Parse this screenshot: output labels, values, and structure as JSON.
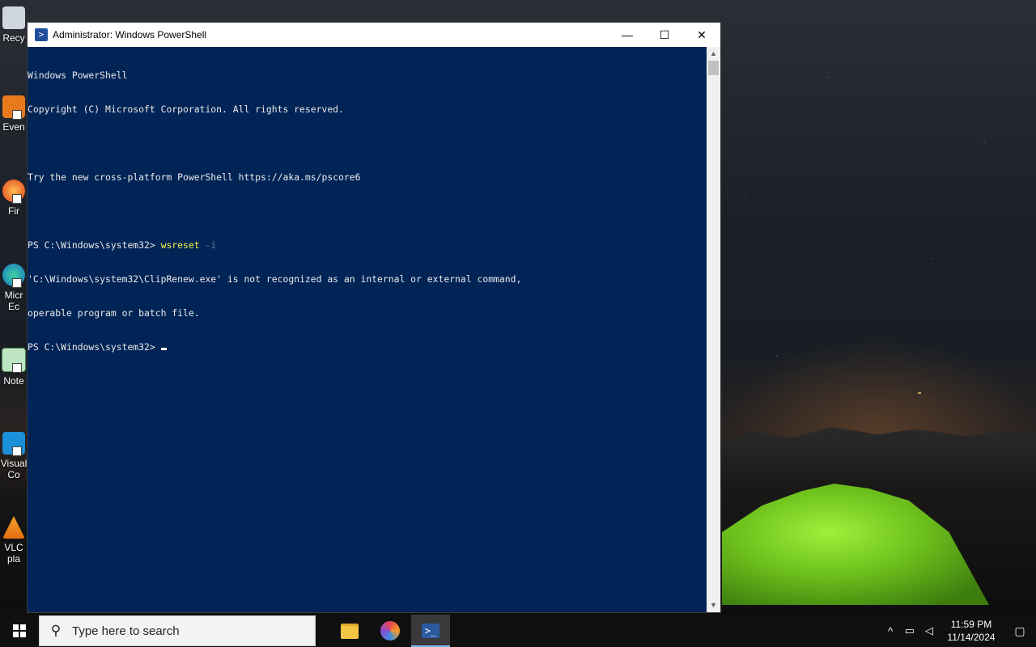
{
  "desktop": {
    "icons": [
      {
        "label": "Recy",
        "name": "recycle-bin-icon"
      },
      {
        "label": "Even",
        "name": "event-shortcut-icon"
      },
      {
        "label": "Fir",
        "name": "firefox-icon"
      },
      {
        "label": "Micr\nEc",
        "name": "edge-icon"
      },
      {
        "label": "Note",
        "name": "notepad-icon"
      },
      {
        "label": "Visual\nCo",
        "name": "vscode-icon"
      },
      {
        "label": "VLC\npla",
        "name": "vlc-icon"
      }
    ]
  },
  "window": {
    "title": "Administrator: Windows PowerShell",
    "controls": {
      "minimize": "—",
      "maximize": "☐",
      "close": "✕"
    }
  },
  "console": {
    "lines": [
      "Windows PowerShell",
      "Copyright (C) Microsoft Corporation. All rights reserved.",
      "",
      "Try the new cross-platform PowerShell https://aka.ms/pscore6",
      "",
      "",
      "'C:\\Windows\\system32\\ClipRenew.exe' is not recognized as an internal or external command,",
      "operable program or batch file."
    ],
    "prompt": "PS C:\\Windows\\system32> ",
    "command": "wsreset",
    "argument": "-i"
  },
  "taskbar": {
    "search_placeholder": "Type here to search",
    "time": "11:59 PM",
    "date": "11/14/2024",
    "apps": [
      "file-explorer",
      "copilot",
      "powershell"
    ]
  },
  "colors": {
    "console_bg": "#012456",
    "console_text": "#eaeaea",
    "command": "#f5f54a",
    "taskbar": "#101010"
  }
}
